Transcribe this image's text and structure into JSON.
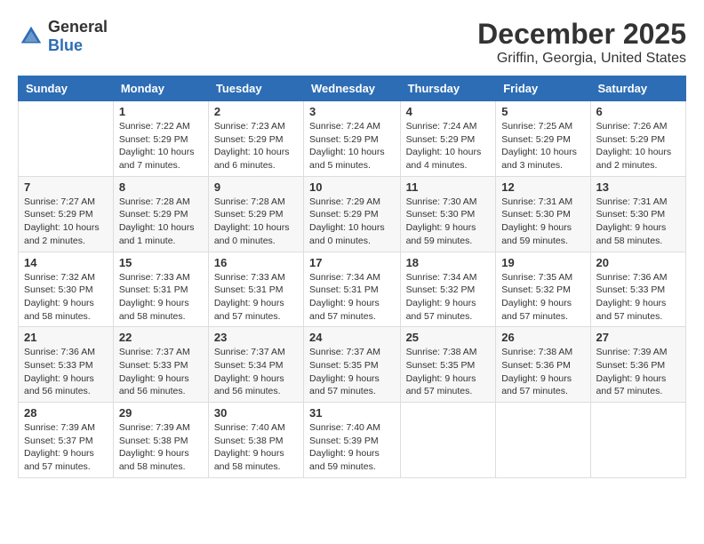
{
  "header": {
    "logo_general": "General",
    "logo_blue": "Blue",
    "month_title": "December 2025",
    "location": "Griffin, Georgia, United States"
  },
  "columns": [
    "Sunday",
    "Monday",
    "Tuesday",
    "Wednesday",
    "Thursday",
    "Friday",
    "Saturday"
  ],
  "rows": [
    [
      {
        "day": "",
        "info": ""
      },
      {
        "day": "1",
        "info": "Sunrise: 7:22 AM\nSunset: 5:29 PM\nDaylight: 10 hours\nand 7 minutes."
      },
      {
        "day": "2",
        "info": "Sunrise: 7:23 AM\nSunset: 5:29 PM\nDaylight: 10 hours\nand 6 minutes."
      },
      {
        "day": "3",
        "info": "Sunrise: 7:24 AM\nSunset: 5:29 PM\nDaylight: 10 hours\nand 5 minutes."
      },
      {
        "day": "4",
        "info": "Sunrise: 7:24 AM\nSunset: 5:29 PM\nDaylight: 10 hours\nand 4 minutes."
      },
      {
        "day": "5",
        "info": "Sunrise: 7:25 AM\nSunset: 5:29 PM\nDaylight: 10 hours\nand 3 minutes."
      },
      {
        "day": "6",
        "info": "Sunrise: 7:26 AM\nSunset: 5:29 PM\nDaylight: 10 hours\nand 2 minutes."
      }
    ],
    [
      {
        "day": "7",
        "info": "Sunrise: 7:27 AM\nSunset: 5:29 PM\nDaylight: 10 hours\nand 2 minutes."
      },
      {
        "day": "8",
        "info": "Sunrise: 7:28 AM\nSunset: 5:29 PM\nDaylight: 10 hours\nand 1 minute."
      },
      {
        "day": "9",
        "info": "Sunrise: 7:28 AM\nSunset: 5:29 PM\nDaylight: 10 hours\nand 0 minutes."
      },
      {
        "day": "10",
        "info": "Sunrise: 7:29 AM\nSunset: 5:29 PM\nDaylight: 10 hours\nand 0 minutes."
      },
      {
        "day": "11",
        "info": "Sunrise: 7:30 AM\nSunset: 5:30 PM\nDaylight: 9 hours\nand 59 minutes."
      },
      {
        "day": "12",
        "info": "Sunrise: 7:31 AM\nSunset: 5:30 PM\nDaylight: 9 hours\nand 59 minutes."
      },
      {
        "day": "13",
        "info": "Sunrise: 7:31 AM\nSunset: 5:30 PM\nDaylight: 9 hours\nand 58 minutes."
      }
    ],
    [
      {
        "day": "14",
        "info": "Sunrise: 7:32 AM\nSunset: 5:30 PM\nDaylight: 9 hours\nand 58 minutes."
      },
      {
        "day": "15",
        "info": "Sunrise: 7:33 AM\nSunset: 5:31 PM\nDaylight: 9 hours\nand 58 minutes."
      },
      {
        "day": "16",
        "info": "Sunrise: 7:33 AM\nSunset: 5:31 PM\nDaylight: 9 hours\nand 57 minutes."
      },
      {
        "day": "17",
        "info": "Sunrise: 7:34 AM\nSunset: 5:31 PM\nDaylight: 9 hours\nand 57 minutes."
      },
      {
        "day": "18",
        "info": "Sunrise: 7:34 AM\nSunset: 5:32 PM\nDaylight: 9 hours\nand 57 minutes."
      },
      {
        "day": "19",
        "info": "Sunrise: 7:35 AM\nSunset: 5:32 PM\nDaylight: 9 hours\nand 57 minutes."
      },
      {
        "day": "20",
        "info": "Sunrise: 7:36 AM\nSunset: 5:33 PM\nDaylight: 9 hours\nand 57 minutes."
      }
    ],
    [
      {
        "day": "21",
        "info": "Sunrise: 7:36 AM\nSunset: 5:33 PM\nDaylight: 9 hours\nand 56 minutes."
      },
      {
        "day": "22",
        "info": "Sunrise: 7:37 AM\nSunset: 5:33 PM\nDaylight: 9 hours\nand 56 minutes."
      },
      {
        "day": "23",
        "info": "Sunrise: 7:37 AM\nSunset: 5:34 PM\nDaylight: 9 hours\nand 56 minutes."
      },
      {
        "day": "24",
        "info": "Sunrise: 7:37 AM\nSunset: 5:35 PM\nDaylight: 9 hours\nand 57 minutes."
      },
      {
        "day": "25",
        "info": "Sunrise: 7:38 AM\nSunset: 5:35 PM\nDaylight: 9 hours\nand 57 minutes."
      },
      {
        "day": "26",
        "info": "Sunrise: 7:38 AM\nSunset: 5:36 PM\nDaylight: 9 hours\nand 57 minutes."
      },
      {
        "day": "27",
        "info": "Sunrise: 7:39 AM\nSunset: 5:36 PM\nDaylight: 9 hours\nand 57 minutes."
      }
    ],
    [
      {
        "day": "28",
        "info": "Sunrise: 7:39 AM\nSunset: 5:37 PM\nDaylight: 9 hours\nand 57 minutes."
      },
      {
        "day": "29",
        "info": "Sunrise: 7:39 AM\nSunset: 5:38 PM\nDaylight: 9 hours\nand 58 minutes."
      },
      {
        "day": "30",
        "info": "Sunrise: 7:40 AM\nSunset: 5:38 PM\nDaylight: 9 hours\nand 58 minutes."
      },
      {
        "day": "31",
        "info": "Sunrise: 7:40 AM\nSunset: 5:39 PM\nDaylight: 9 hours\nand 59 minutes."
      },
      {
        "day": "",
        "info": ""
      },
      {
        "day": "",
        "info": ""
      },
      {
        "day": "",
        "info": ""
      }
    ]
  ]
}
